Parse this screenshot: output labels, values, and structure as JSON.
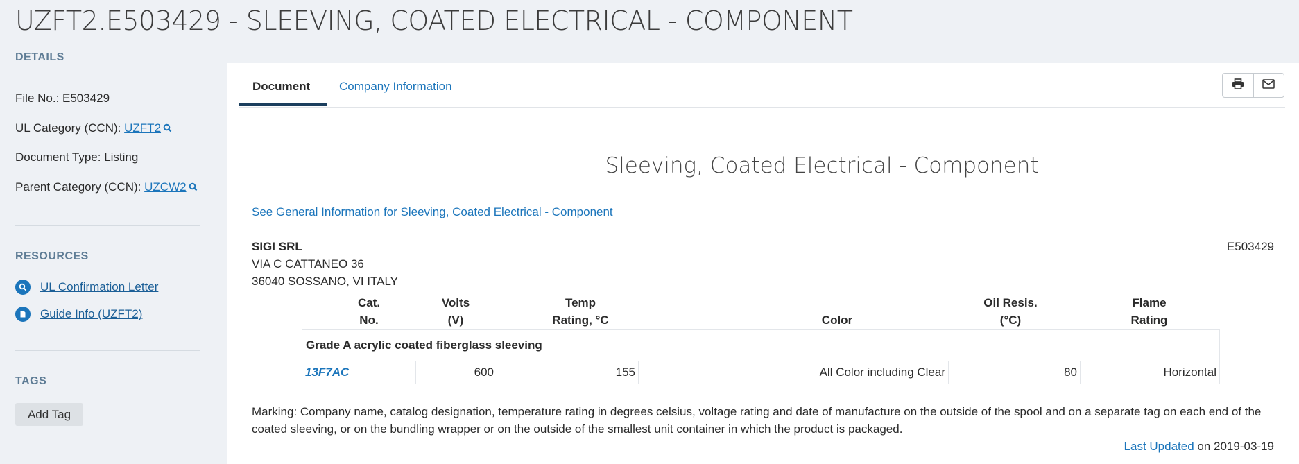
{
  "page_title": "UZFT2.E503429 - SLEEVING, COATED ELECTRICAL - COMPONENT",
  "sidebar": {
    "details_heading": "DETAILS",
    "file_no_label": "File No.: E503429",
    "ul_category_label": "UL Category (CCN): ",
    "ul_category_link": "UZFT2",
    "document_type": "Document Type: Listing",
    "parent_category_label": "Parent Category (CCN): ",
    "parent_category_link": "UZCW2",
    "resources_heading": "RESOURCES",
    "resources": [
      {
        "label": "UL Confirmation Letter",
        "icon": "search-icon"
      },
      {
        "label": "Guide Info (UZFT2)",
        "icon": "document-icon"
      }
    ],
    "tags_heading": "TAGS",
    "add_tag_label": "Add Tag"
  },
  "tabs": [
    {
      "label": "Document",
      "active": true
    },
    {
      "label": "Company Information",
      "active": false
    }
  ],
  "toolbar": {
    "icons": [
      "print-icon",
      "email-icon"
    ]
  },
  "document": {
    "heading": "Sleeving, Coated Electrical - Component",
    "general_info_link": "See General Information for Sleeving, Coated Electrical - Component",
    "company": {
      "name": "SIGI SRL",
      "address_line1": "VIA C CATTANEO 36",
      "address_line2": "36040 SOSSANO, VI ITALY",
      "file_no": "E503429"
    },
    "table": {
      "headers": [
        {
          "line1": "Cat.",
          "line2": "No."
        },
        {
          "line1": "Volts",
          "line2": "(V)"
        },
        {
          "line1": "Temp",
          "line2": "Rating, °C"
        },
        {
          "line1": "",
          "line2": "Color"
        },
        {
          "line1": "Oil Resis.",
          "line2": "(°C)"
        },
        {
          "line1": "Flame",
          "line2": "Rating"
        }
      ],
      "group_label": "Grade A acrylic coated fiberglass sleeving",
      "rows": [
        {
          "cat_no": "13F7AC",
          "volts": "600",
          "temp": "155",
          "color": "All Color including Clear",
          "oil": "80",
          "flame": "Horizontal"
        }
      ]
    },
    "marking": "Marking: Company name, catalog designation, temperature rating in degrees celsius, voltage rating and date of manufacture on the outside of the spool and on a separate tag on each end of the coated sleeving, or on the bundling wrapper or on the outside of the smallest unit container in which the product is packaged.",
    "last_updated_label": "Last Updated",
    "last_updated_value": " on 2019-03-19"
  },
  "colors": {
    "accent": "#1b75bb",
    "heading": "#5e7c95",
    "background": "#eef1f5"
  }
}
